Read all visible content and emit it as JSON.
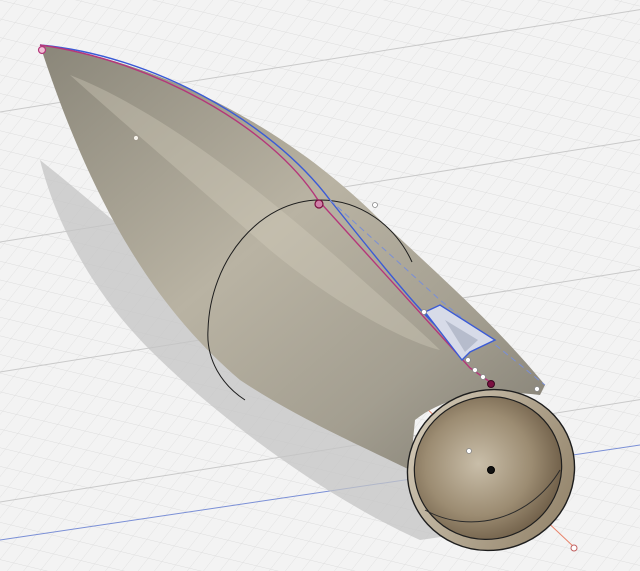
{
  "viewport": {
    "background": "#f3f3f3",
    "grid_minor_color": "#dcdcdc",
    "grid_major_color": "#c9c9c9"
  },
  "axes": {
    "x_axis_color": "#e8836a",
    "y_axis_color": "#7a8fd6"
  },
  "body": {
    "surface_color": "#a39e90",
    "edge_color": "#1e1e1e",
    "inner_color": "#7c6a52",
    "shadow_color": "#bdbdbd"
  },
  "sketch": {
    "profile_color": "#3b5bd6",
    "section_line_color": "#b5367a",
    "constraint_point_color": "#ffffff",
    "selected_point_color": "#7a1040",
    "fin_color": "#3b5bd6"
  },
  "icons": [
    "origin-point-icon",
    "constraint-point-icon",
    "sketch-point-icon"
  ]
}
